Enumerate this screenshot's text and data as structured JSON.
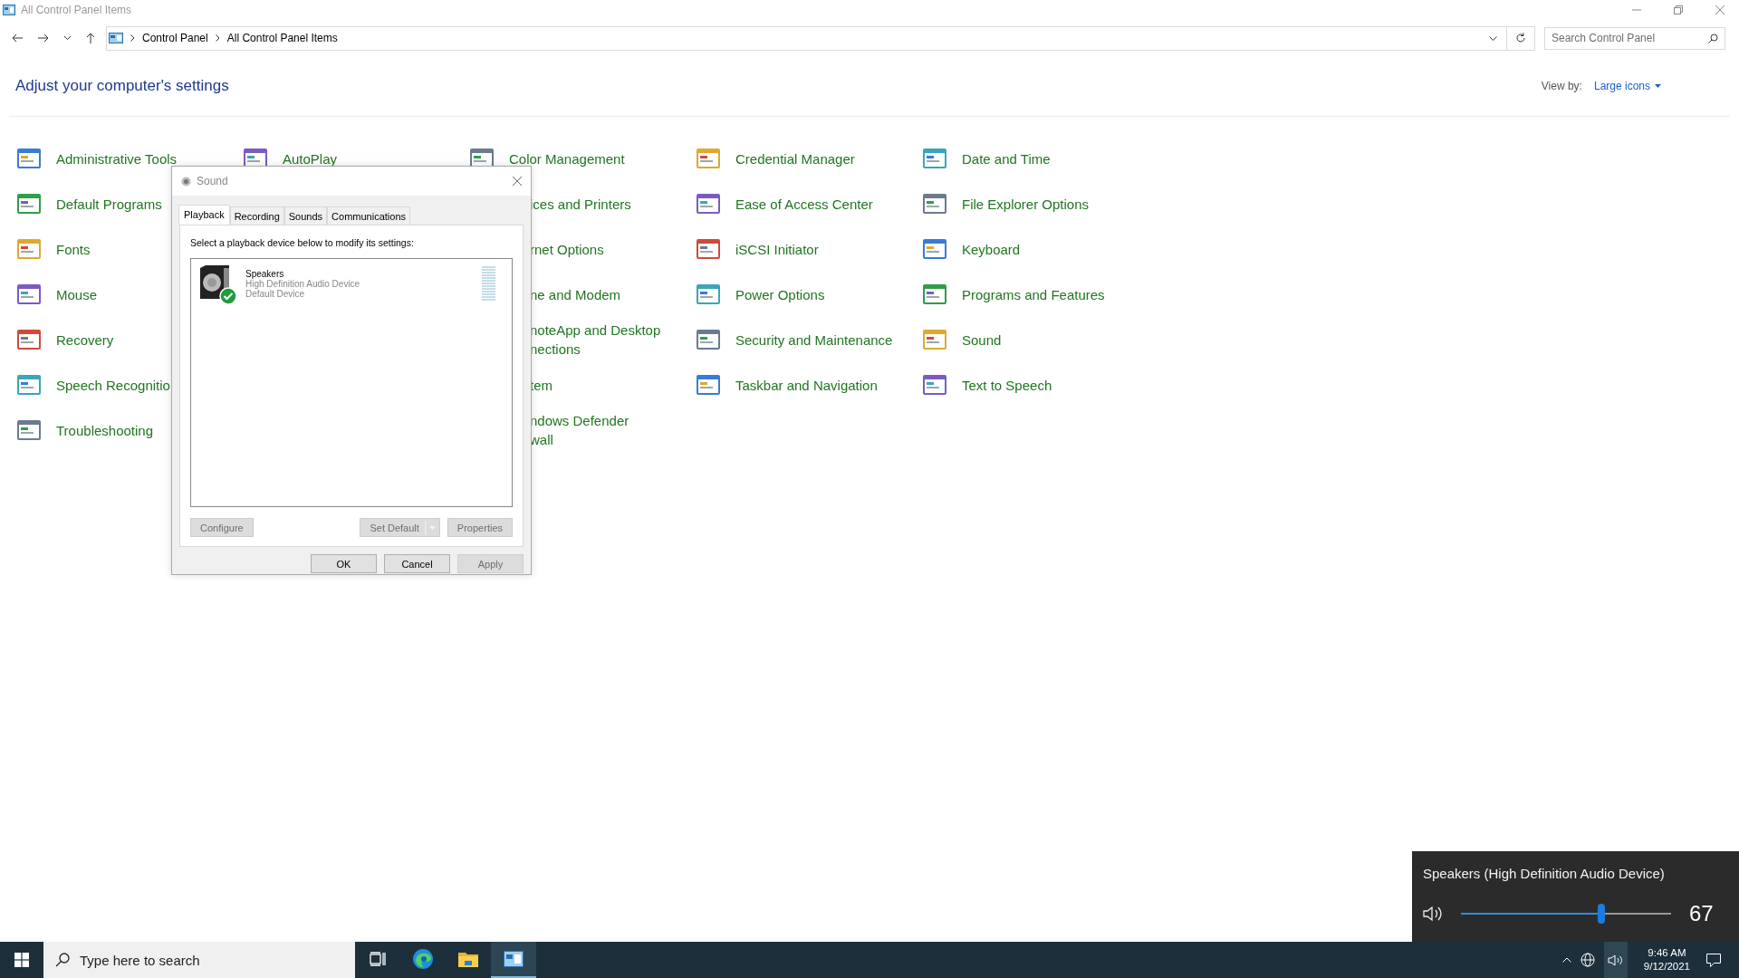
{
  "window": {
    "title": "All Control Panel Items"
  },
  "address_bar": {
    "breadcrumbs": [
      "Control Panel",
      "All Control Panel Items"
    ]
  },
  "search": {
    "placeholder": "Search Control Panel"
  },
  "heading": "Adjust your computer's settings",
  "view_by": {
    "label": "View by:",
    "value": "Large icons"
  },
  "columns": [
    [
      {
        "kind": "full",
        "lines": [
          "Administrative Tools"
        ]
      },
      {
        "kind": "full",
        "lines": [
          "Default Programs"
        ]
      },
      {
        "kind": "full",
        "lines": [
          "Fonts"
        ]
      },
      {
        "kind": "full",
        "lines": [
          "Mouse"
        ]
      },
      {
        "kind": "full",
        "lines": [
          "Recovery"
        ]
      },
      {
        "kind": "full",
        "lines": [
          "Speech Recognitio"
        ]
      },
      {
        "kind": "full",
        "lines": [
          "Troubleshooting"
        ]
      }
    ],
    [
      {
        "kind": "full",
        "lines": [
          "AutoPlay"
        ]
      }
    ],
    [
      {
        "kind": "full",
        "lines": [
          "Color Management"
        ]
      },
      {
        "kind": "partial",
        "lines": [
          "ices and Printers"
        ]
      },
      {
        "kind": "partial",
        "lines": [
          "rnet Options"
        ]
      },
      {
        "kind": "partial",
        "lines": [
          "ne and Modem"
        ]
      },
      {
        "kind": "partial",
        "lines": [
          "noteApp and Desktop",
          "nections"
        ]
      },
      {
        "kind": "partial",
        "lines": [
          "tem"
        ]
      },
      {
        "kind": "partial",
        "lines": [
          "ndows Defender",
          "wall"
        ]
      }
    ],
    [
      {
        "kind": "full",
        "lines": [
          "Credential Manager"
        ]
      },
      {
        "kind": "full",
        "lines": [
          "Ease of Access Center"
        ]
      },
      {
        "kind": "full",
        "lines": [
          "iSCSI Initiator"
        ]
      },
      {
        "kind": "full",
        "lines": [
          "Power Options"
        ]
      },
      {
        "kind": "full",
        "lines": [
          "Security and Maintenance"
        ]
      },
      {
        "kind": "full",
        "lines": [
          "Taskbar and Navigation"
        ]
      }
    ],
    [
      {
        "kind": "full",
        "lines": [
          "Date and Time"
        ]
      },
      {
        "kind": "full",
        "lines": [
          "File Explorer Options"
        ]
      },
      {
        "kind": "full",
        "lines": [
          "Keyboard"
        ]
      },
      {
        "kind": "full",
        "lines": [
          "Programs and Features"
        ]
      },
      {
        "kind": "full",
        "lines": [
          "Sound"
        ]
      },
      {
        "kind": "full",
        "lines": [
          "Text to Speech"
        ]
      }
    ]
  ],
  "dialog": {
    "title": "Sound",
    "tabs": [
      {
        "label": "Playback",
        "selected": true
      },
      {
        "label": "Recording",
        "selected": false
      },
      {
        "label": "Sounds",
        "selected": false
      },
      {
        "label": "Communications",
        "selected": false
      }
    ],
    "instruction": "Select a playback device below to modify its settings:",
    "devices": [
      {
        "name": "Speakers",
        "description": "High Definition Audio Device",
        "status": "Default Device",
        "is_default": true
      }
    ],
    "buttons": [
      {
        "label": "Configure",
        "disabled": true,
        "kind": "plain"
      },
      {
        "label": "Set Default",
        "disabled": true,
        "kind": "split"
      },
      {
        "label": "Properties",
        "disabled": true,
        "kind": "plain"
      }
    ],
    "footer_buttons": [
      {
        "label": "OK",
        "disabled": false
      },
      {
        "label": "Cancel",
        "disabled": false
      },
      {
        "label": "Apply",
        "disabled": true
      }
    ]
  },
  "volume_flyout": {
    "device": "Speakers (High Definition Audio Device)",
    "level": 0.67,
    "reading": "67"
  },
  "taskbar": {
    "search_placeholder": "Type here to search",
    "apps": [
      {
        "kind": "task-view",
        "selected": false
      },
      {
        "kind": "browser",
        "selected": false
      },
      {
        "kind": "folder",
        "selected": false
      },
      {
        "kind": "control-panel",
        "selected": true
      }
    ],
    "volume_selected": true,
    "clock": {
      "time": "9:46 AM",
      "date": "9/12/2021"
    }
  }
}
